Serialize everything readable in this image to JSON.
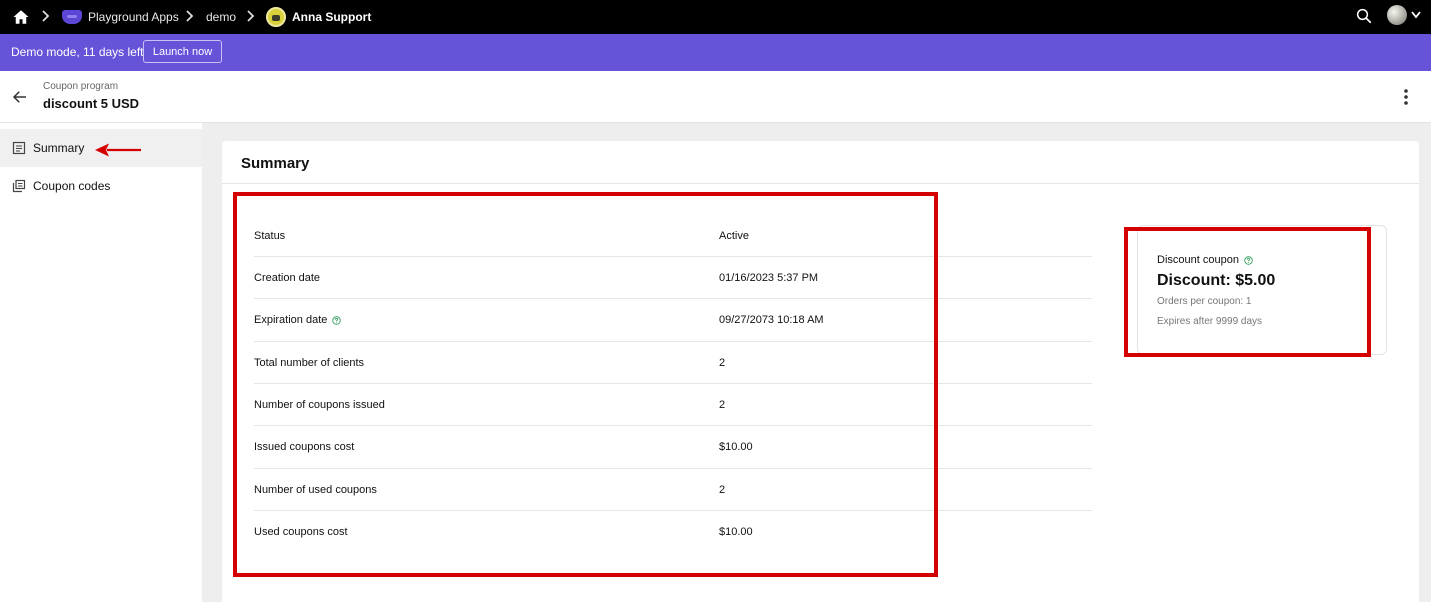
{
  "topbar": {
    "breadcrumbs": [
      "Playground Apps",
      "demo",
      "Anna Support"
    ]
  },
  "banner": {
    "text": "Demo mode, 11 days left",
    "launch_label": "Launch now"
  },
  "header": {
    "subtitle": "Coupon program",
    "title": "discount 5 USD"
  },
  "sidebar": {
    "items": [
      {
        "label": "Summary",
        "active": true
      },
      {
        "label": "Coupon codes",
        "active": false
      }
    ]
  },
  "summary": {
    "title": "Summary",
    "rows": [
      {
        "label": "Status",
        "value": "Active"
      },
      {
        "label": "Creation date",
        "value": "01/16/2023 5:37 PM"
      },
      {
        "label": "Expiration date",
        "value": "09/27/2073 10:18 AM"
      },
      {
        "label": "Total number of clients",
        "value": "2"
      },
      {
        "label": "Number of coupons issued",
        "value": "2"
      },
      {
        "label": "Issued coupons cost",
        "value": "$10.00"
      },
      {
        "label": "Number of used coupons",
        "value": "2"
      },
      {
        "label": "Used coupons cost",
        "value": "$10.00"
      }
    ]
  },
  "discount_card": {
    "kind": "Discount coupon",
    "amount": "Discount: $5.00",
    "orders_per_coupon": "Orders per coupon: 1",
    "expires": "Expires after 9999 days"
  },
  "colors": {
    "topbar": "#000000",
    "banner": "#6553d8",
    "annotation": "#d40000",
    "help_icon": "#2e9e5b"
  }
}
